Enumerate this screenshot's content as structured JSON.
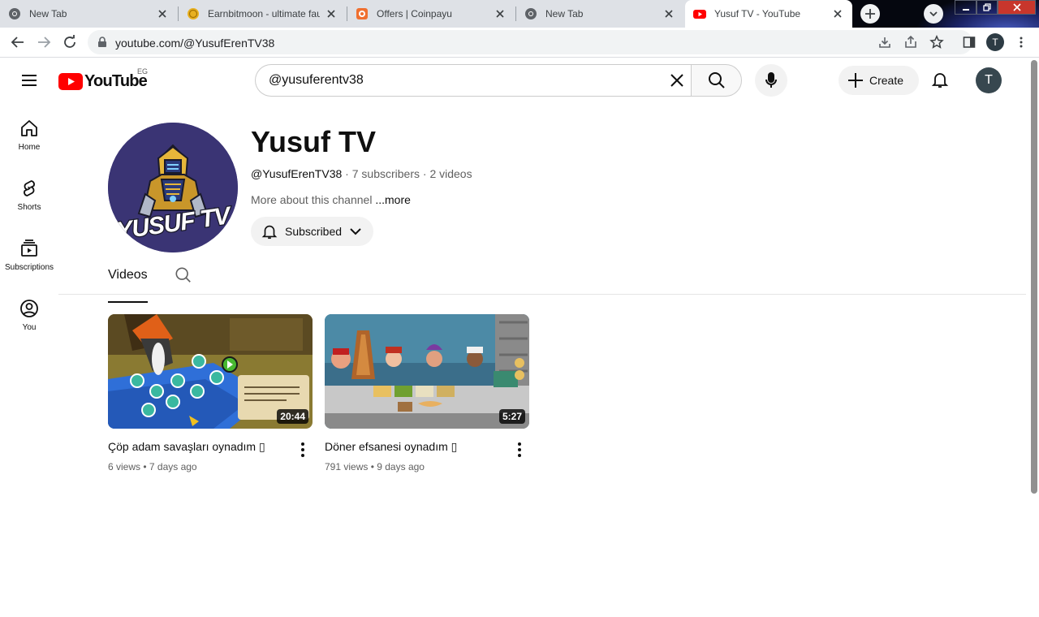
{
  "browser": {
    "tabs": [
      {
        "title": "New Tab",
        "favicon": "chrome-icon"
      },
      {
        "title": "Earnbitmoon - ultimate fau",
        "favicon": "coin-icon"
      },
      {
        "title": "Offers | Coinpayu",
        "favicon": "coinpayu-icon"
      },
      {
        "title": "New Tab",
        "favicon": "chrome-icon"
      },
      {
        "title": "Yusuf TV - YouTube",
        "favicon": "youtube-icon"
      }
    ],
    "url": "youtube.com/@YusufErenTV38",
    "profile_initial": "T"
  },
  "header": {
    "logo_text": "YouTube",
    "region": "EG",
    "search_value": "@yusuferentv38",
    "create_label": "Create",
    "avatar_initial": "T"
  },
  "guide": [
    {
      "label": "Home",
      "icon": "home-icon"
    },
    {
      "label": "Shorts",
      "icon": "shorts-icon"
    },
    {
      "label": "Subscriptions",
      "icon": "subscriptions-icon"
    },
    {
      "label": "You",
      "icon": "you-icon"
    }
  ],
  "channel": {
    "name": "Yusuf TV",
    "handle": "@YusufErenTV38",
    "subscribers": "7 subscribers",
    "videos_count": "2 videos",
    "separator": " · ",
    "about": "More about this channel",
    "more": " ...more",
    "subscribed_label": "Subscribed",
    "avatar_text": "YUSUF TV"
  },
  "tabs": {
    "videos": "Videos"
  },
  "videos": [
    {
      "title": "Çöp adam savaşları oynadım ▯",
      "views": "6 views",
      "age": "7 days ago",
      "duration": "20:44"
    },
    {
      "title": "Döner efsanesi oynadım ▯",
      "views": "791 views",
      "age": "9 days ago",
      "duration": "5:27"
    }
  ],
  "meta_dot": " • ",
  "colors": {
    "yt_red": "#ff0000",
    "avatar_bg": "#3a3474",
    "chrome_tabstrip": "#dee1e6"
  }
}
